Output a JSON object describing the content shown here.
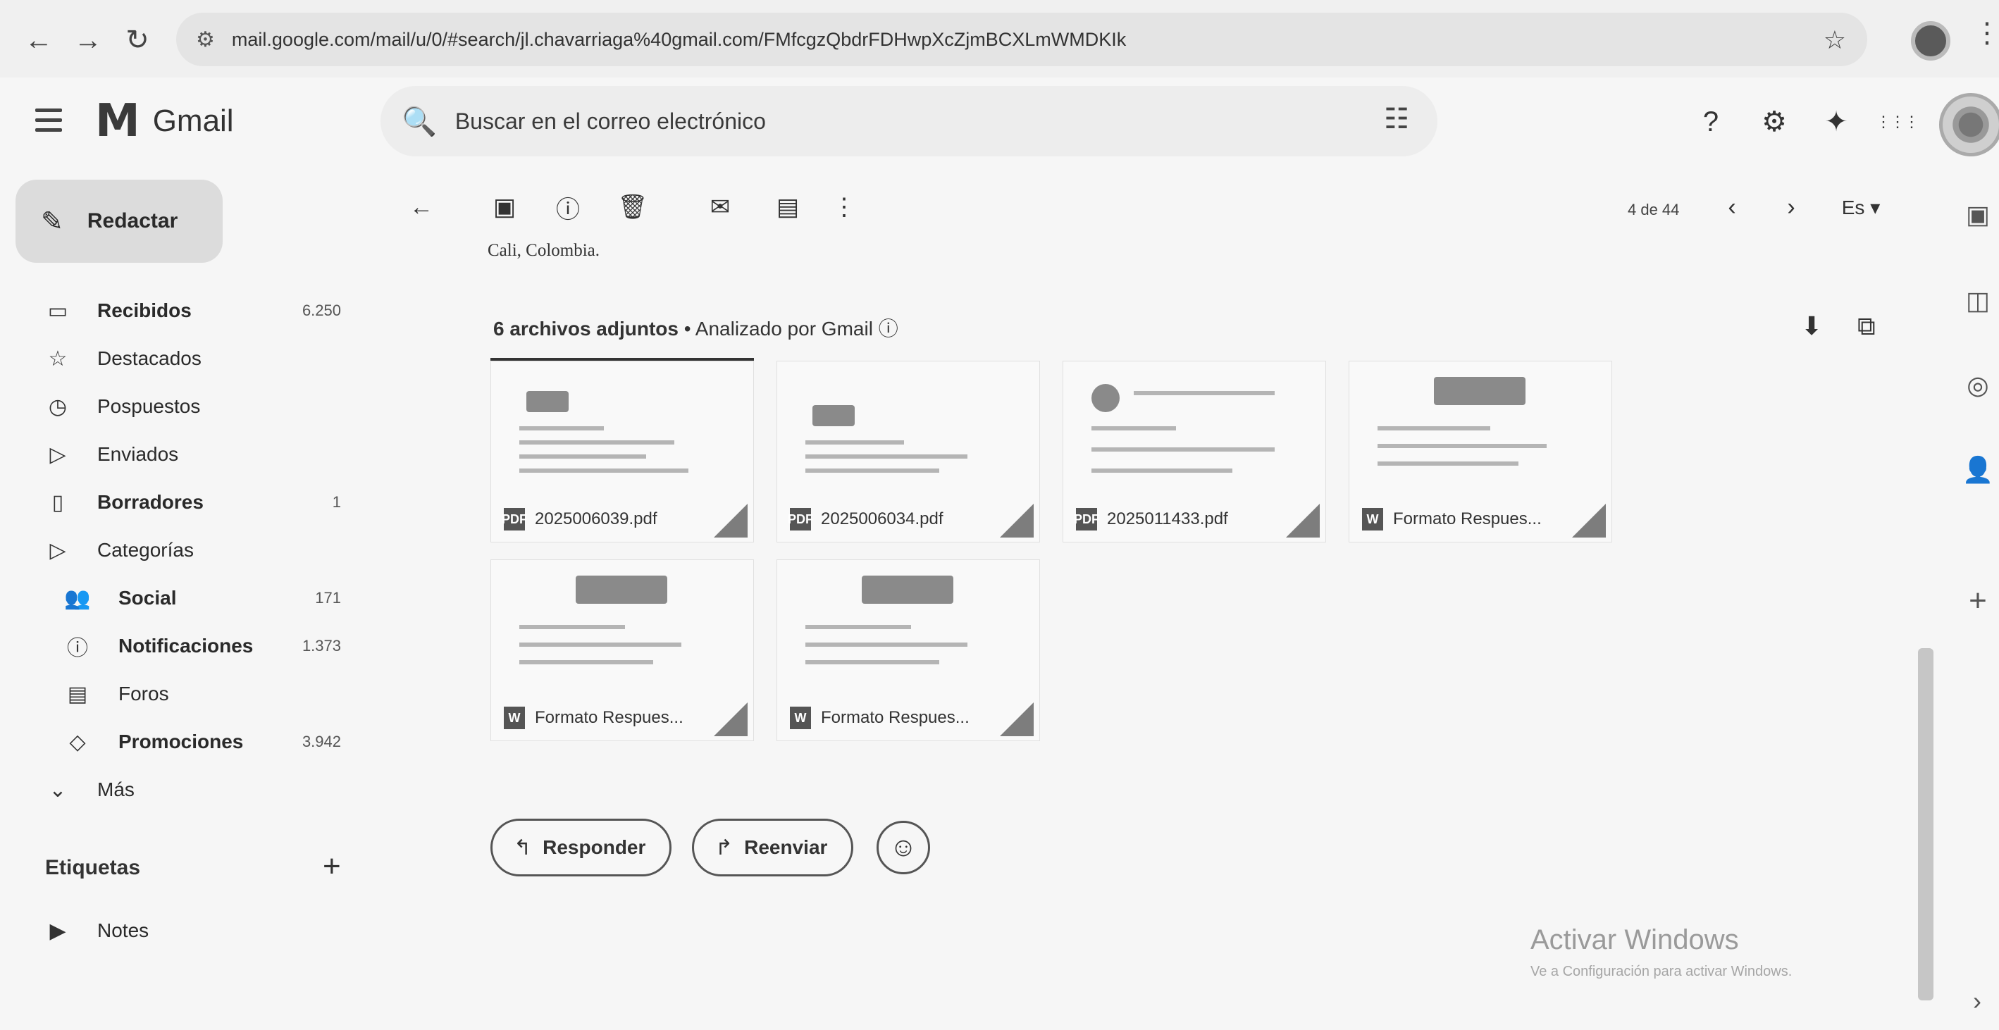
{
  "browser": {
    "url": "mail.google.com/mail/u/0/#search/jl.chavarriaga%40gmail.com/FMfcgzQbdrFDHwpXcZjmBCXLmWMDKIk",
    "back_glyph": "←",
    "forward_glyph": "→",
    "reload_glyph": "↻",
    "site_glyph": "⚙",
    "star_glyph": "☆",
    "menu_glyph": "⋮"
  },
  "header": {
    "menu_icon": "hamburger-icon",
    "logo_text": "Gmail",
    "search_placeholder": "Buscar en el correo electrónico",
    "search_glyph": "🔍",
    "filter_glyph": "☷",
    "icons": [
      "help-icon",
      "settings-icon",
      "gemini-icon",
      "apps-icon"
    ],
    "help_glyph": "?",
    "settings_glyph": "⚙",
    "gemini_glyph": "✦",
    "apps_glyph": "⋮⋮⋮"
  },
  "compose": {
    "label": "Redactar",
    "glyph": "✎"
  },
  "sidebar": {
    "items": [
      {
        "label": "Recibidos",
        "count": "6.250",
        "bold": true,
        "glyph": "▭"
      },
      {
        "label": "Destacados",
        "count": "",
        "bold": false,
        "glyph": "☆"
      },
      {
        "label": "Pospuestos",
        "count": "",
        "bold": false,
        "glyph": "◷"
      },
      {
        "label": "Enviados",
        "count": "",
        "bold": false,
        "glyph": "▷"
      },
      {
        "label": "Borradores",
        "count": "1",
        "bold": true,
        "glyph": "▯"
      },
      {
        "label": "Categorías",
        "count": "",
        "bold": false,
        "glyph": "▷"
      },
      {
        "label": "Social",
        "count": "171",
        "bold": true,
        "glyph": "👥"
      },
      {
        "label": "Notificaciones",
        "count": "1.373",
        "bold": true,
        "glyph": "ⓘ"
      },
      {
        "label": "Foros",
        "count": "",
        "bold": false,
        "glyph": "▤"
      },
      {
        "label": "Promociones",
        "count": "3.942",
        "bold": true,
        "glyph": "◇"
      },
      {
        "label": "Más",
        "count": "",
        "bold": false,
        "glyph": "⌄"
      }
    ],
    "labels_heading": "Etiquetas",
    "labels_add_glyph": "+",
    "labels": [
      {
        "label": "Notes",
        "glyph": "▶"
      }
    ]
  },
  "toolbar": {
    "back_glyph": "←",
    "archive_glyph": "▣",
    "report_glyph": "ⓘ",
    "delete_glyph": "🗑",
    "mark_unread_glyph": "✉",
    "move_glyph": "▤",
    "more_glyph": "⋮",
    "pager_text": "4 de 44",
    "prev_glyph": "‹",
    "next_glyph": "›",
    "lang": "Es ▾"
  },
  "message": {
    "sender_location": "Cali, Colombia."
  },
  "attachments": {
    "count_label": "6 archivos adjuntos",
    "scanned_label": "• Analizado por Gmail ⓘ",
    "download_glyph": "⬇",
    "drive_glyph": "⧉",
    "files": [
      {
        "name": "2025006039.pdf",
        "type": "pdf",
        "icon_letter": "PDF"
      },
      {
        "name": "2025006034.pdf",
        "type": "pdf",
        "icon_letter": "PDF"
      },
      {
        "name": "2025011433.pdf",
        "type": "pdf",
        "icon_letter": "PDF"
      },
      {
        "name": "Formato Respues...",
        "type": "doc",
        "icon_letter": "W"
      },
      {
        "name": "Formato Respues...",
        "type": "doc",
        "icon_letter": "W"
      },
      {
        "name": "Formato Respues...",
        "type": "doc",
        "icon_letter": "W"
      }
    ]
  },
  "actions": {
    "reply_label": "Responder",
    "reply_glyph": "↰",
    "forward_label": "Reenviar",
    "forward_glyph": "↱",
    "emoji_glyph": "☺"
  },
  "side_panel": {
    "icons": [
      "calendar-icon",
      "keep-icon",
      "tasks-icon",
      "contacts-icon",
      "add-icon"
    ],
    "calendar_glyph": "▣",
    "keep_glyph": "◫",
    "tasks_glyph": "◎",
    "contacts_glyph": "👤",
    "add_glyph": "+"
  },
  "windows_watermark": {
    "title": "Activar Windows",
    "subtitle": "Ve a Configuración para activar Windows."
  },
  "colors": {
    "background": "#f6f6f6",
    "text": "#2a2a2a",
    "accent": "#555555"
  }
}
